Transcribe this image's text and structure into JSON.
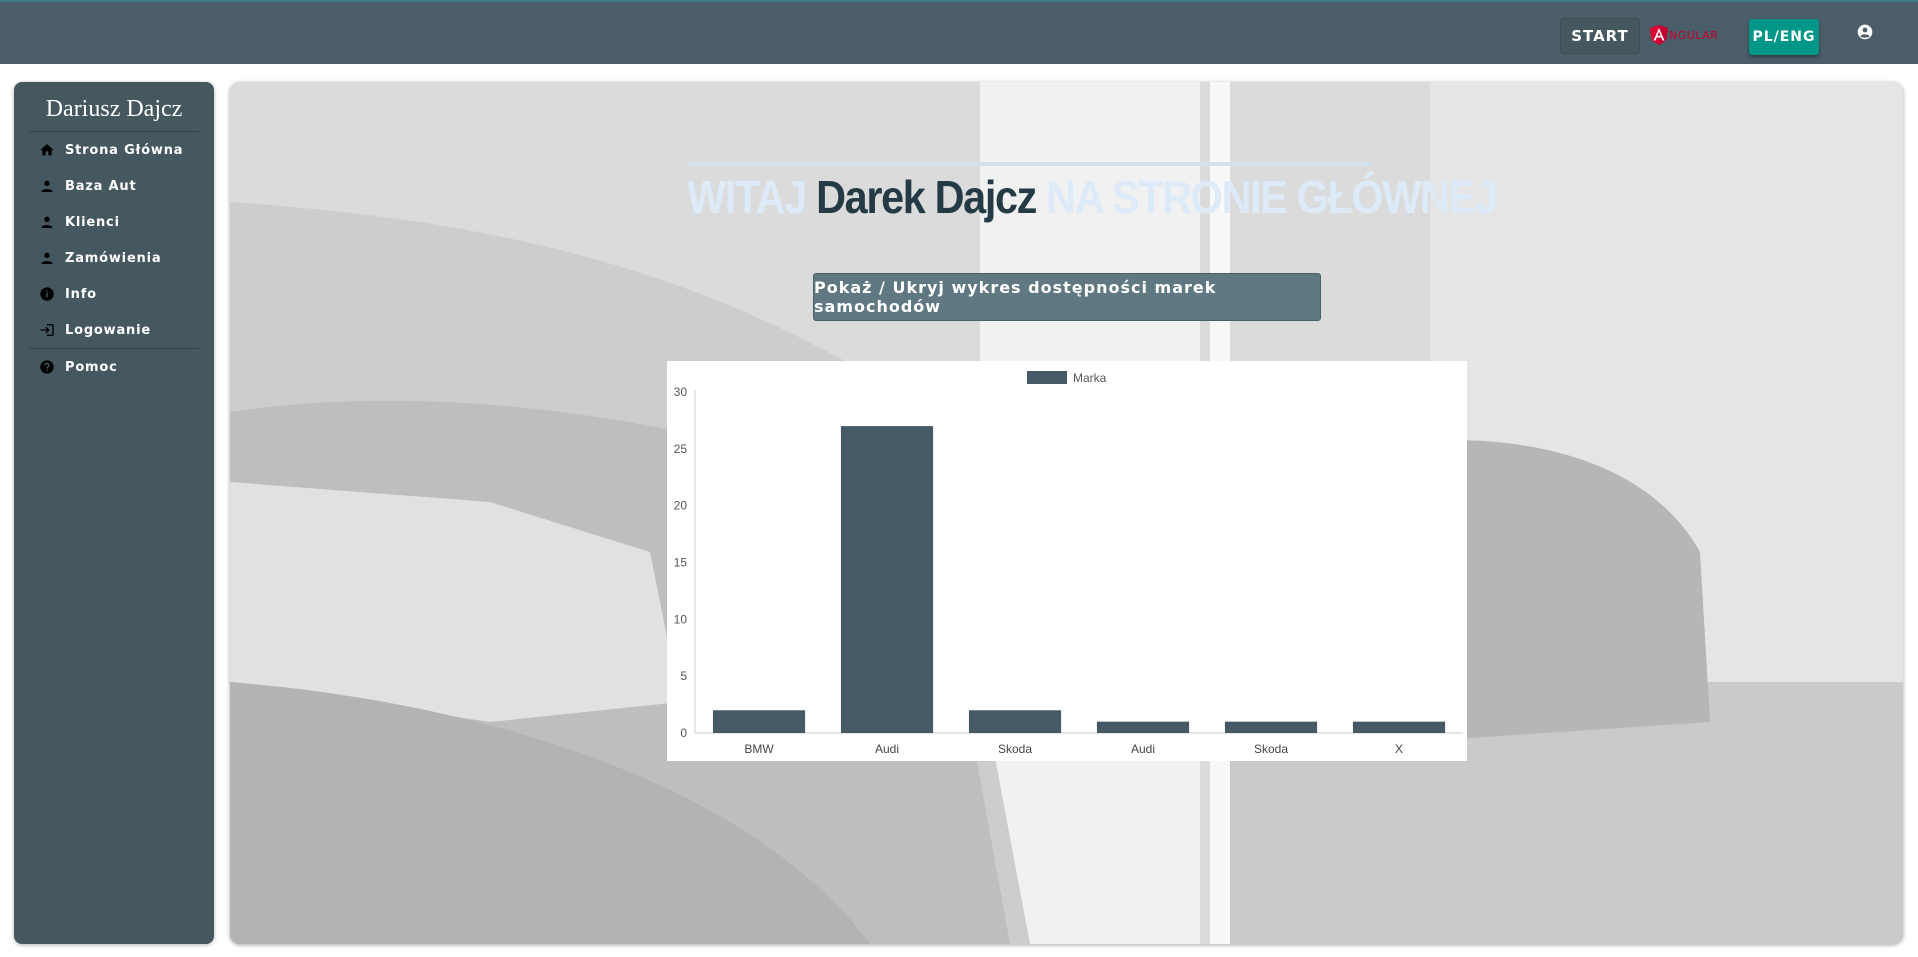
{
  "topbar": {
    "start_label": "START",
    "angular_label": "NGULAR",
    "lang_label": "PL/ENG",
    "account_icon": "account-circle-icon"
  },
  "sidebar": {
    "title": "Dariusz Dajcz",
    "items": [
      {
        "label": "Strona Główna",
        "icon": "home-icon"
      },
      {
        "label": "Baza Aut",
        "icon": "person-icon"
      },
      {
        "label": "Klienci",
        "icon": "person-icon"
      },
      {
        "label": "Zamówienia",
        "icon": "person-icon"
      },
      {
        "label": "Info",
        "icon": "info-icon"
      },
      {
        "label": "Logowanie",
        "icon": "login-icon"
      },
      {
        "label": "Pomoc",
        "icon": "help-icon"
      }
    ]
  },
  "main": {
    "welcome_prefix": "WITAJ ",
    "welcome_name": "Darek Dajcz",
    "welcome_suffix": " NA STRONIE GŁÓWNEJ",
    "toggle_label": "Pokaż / Ukryj wykres dostępności marek samochodów"
  },
  "colors": {
    "topbar": "#4a5d68",
    "sidebar": "#45575f",
    "accent": "#009688",
    "bar": "#455a64"
  },
  "chart_data": {
    "type": "bar",
    "categories": [
      "BMW",
      "Audi",
      "Skoda",
      "Audi",
      "Skoda",
      "X"
    ],
    "series": [
      {
        "name": "Marka",
        "values": [
          2,
          27,
          2,
          1,
          1,
          1
        ]
      }
    ],
    "ylim": [
      0,
      30
    ],
    "yticks": [
      0,
      5,
      10,
      15,
      20,
      25,
      30
    ],
    "legend": "top",
    "grid": false
  }
}
